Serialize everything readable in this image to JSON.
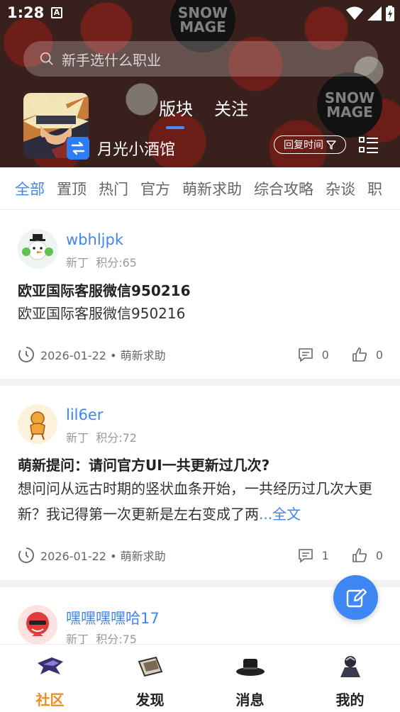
{
  "status_bar": {
    "time": "1:28",
    "a_indicator": "A"
  },
  "search": {
    "placeholder": "新手选什么职业"
  },
  "banner": {
    "watermark_line1": "SNOW",
    "watermark_line2": "MAGE",
    "forum_name": "月光小酒馆",
    "tabs": [
      {
        "label": "版块",
        "active": true
      },
      {
        "label": "关注",
        "active": false
      }
    ],
    "sort_label": "回复时间"
  },
  "categories": [
    "全部",
    "置顶",
    "热门",
    "官方",
    "萌新求助",
    "综合攻略",
    "杂谈",
    "职"
  ],
  "posts": [
    {
      "username": "wbhljpk",
      "level": "新丁",
      "points": "积分:65",
      "title": "欧亚国际客服微信950216",
      "body": "欧亚国际客服微信950216",
      "more": "",
      "date_section": "2026-01-22 • 萌新求助",
      "comments": "0",
      "likes": "0"
    },
    {
      "username": "lil6er",
      "level": "新丁",
      "points": "积分:72",
      "title": "萌新提问：请问官方UI一共更新过几次?",
      "body": "想问问从远古时期的竖状血条开始，一共经历过几次大更新？我记得第一次更新是左右变成了两",
      "more": "...全文",
      "date_section": "2026-01-22 • 萌新求助",
      "comments": "1",
      "likes": "0"
    },
    {
      "username": "嘿嘿嘿嘿哈17",
      "level": "新丁",
      "points": "积分:75"
    }
  ],
  "bottom_nav": [
    {
      "label": "社区",
      "active": true
    },
    {
      "label": "发现",
      "active": false
    },
    {
      "label": "消息",
      "active": false
    },
    {
      "label": "我的",
      "active": false
    }
  ],
  "colors": {
    "accent": "#3f86f5",
    "nav_active": "#f08c1a"
  }
}
